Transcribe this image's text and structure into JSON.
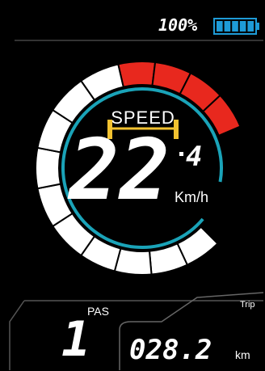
{
  "display": {
    "battery": {
      "percent_text": "100%",
      "level": 1.0,
      "bars": 5,
      "color": "#1e9bd7"
    },
    "speed": {
      "label": "SPEED",
      "integer": "22",
      "decimal": "4",
      "unit": "Km/h",
      "colors": {
        "ring": "#1aa3b8",
        "bracket": "#f2c230",
        "segment_normal": "#ffffff",
        "segment_warning": "#e8281e"
      }
    },
    "assist": {
      "label": "PAS",
      "level": "1"
    },
    "trip": {
      "label": "Trip",
      "value": "028.2",
      "unit": "km"
    }
  }
}
